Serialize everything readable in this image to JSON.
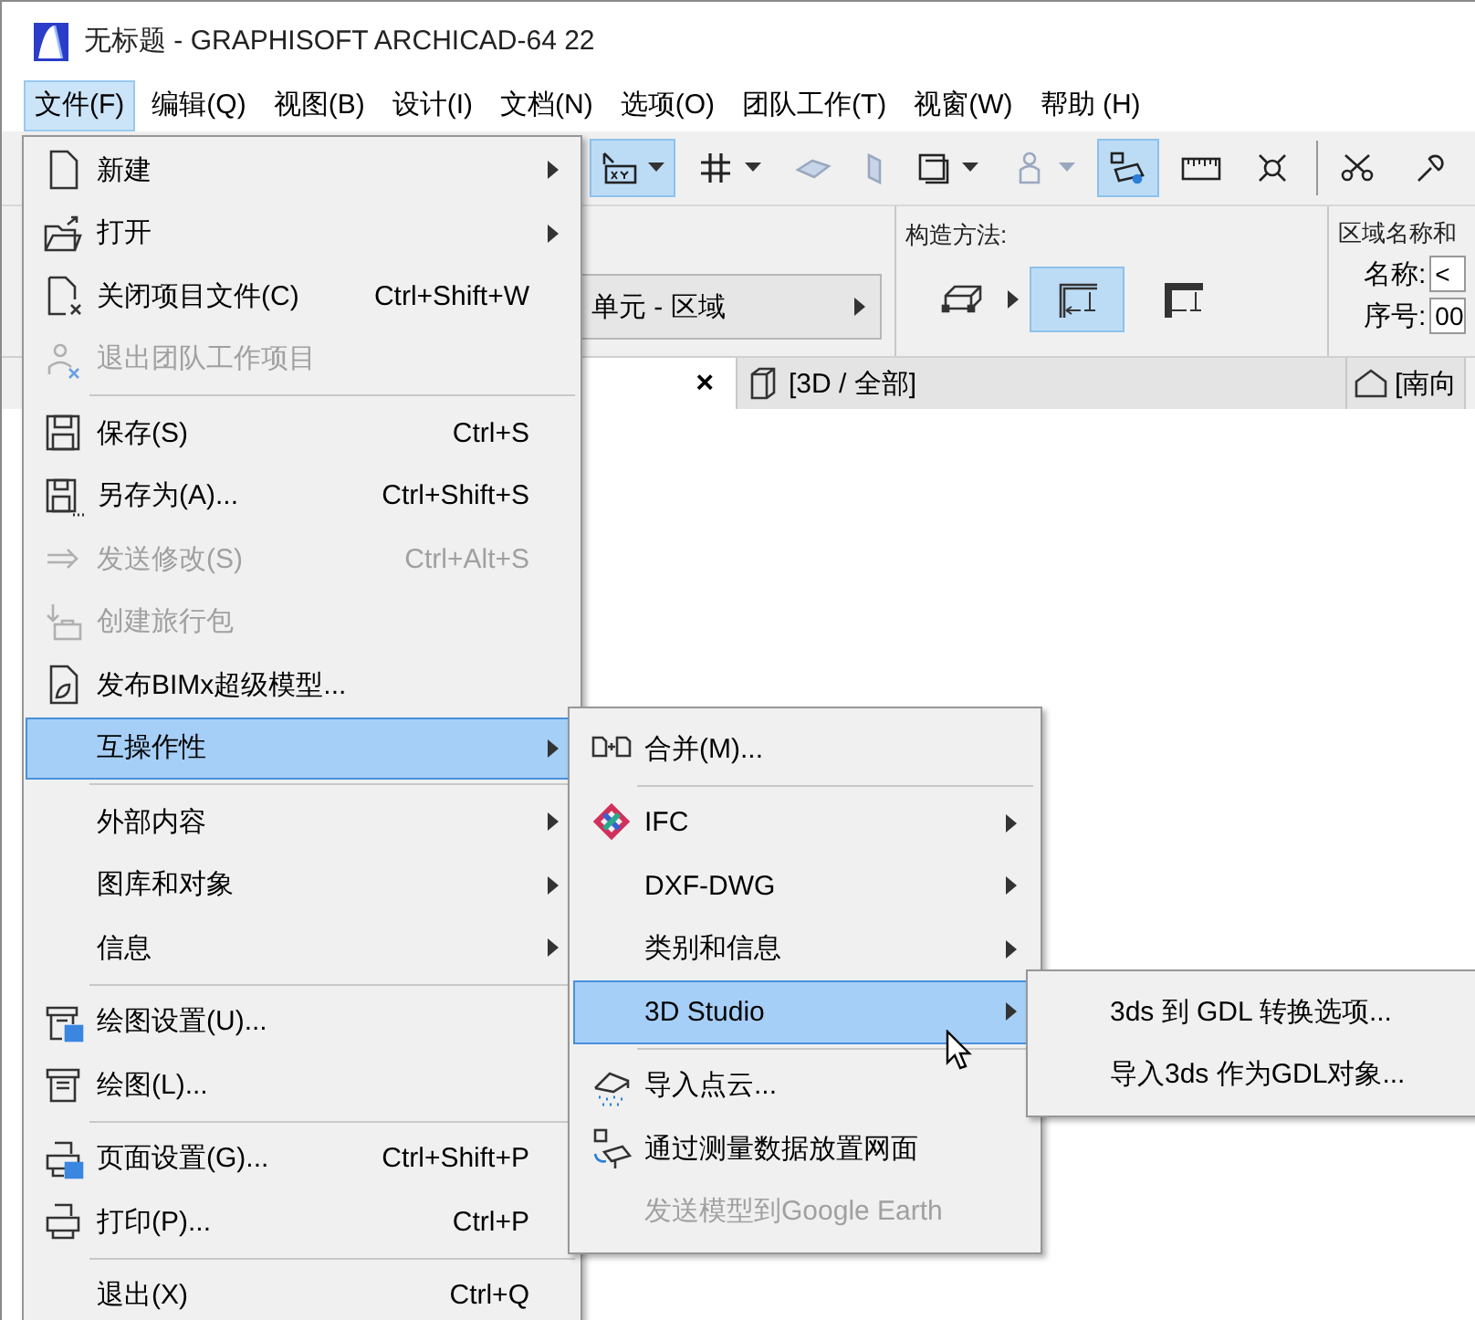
{
  "window": {
    "title": "无标题 - GRAPHISOFT ARCHICAD-64 22"
  },
  "menubar": [
    {
      "label": "文件(F)",
      "selected": true
    },
    {
      "label": "编辑(Q)",
      "selected": false
    },
    {
      "label": "视图(B)",
      "selected": false
    },
    {
      "label": "设计(I)",
      "selected": false
    },
    {
      "label": "文档(N)",
      "selected": false
    },
    {
      "label": "选项(O)",
      "selected": false
    },
    {
      "label": "团队工作(T)",
      "selected": false
    },
    {
      "label": "视窗(W)",
      "selected": false
    },
    {
      "label": "帮助 (H)",
      "selected": false
    }
  ],
  "toolbar": [
    {
      "selected": true,
      "disabled": false,
      "dropdown": true
    },
    {
      "selected": false,
      "disabled": false,
      "dropdown": true
    },
    {
      "selected": false,
      "disabled": true,
      "dropdown": false
    },
    {
      "selected": false,
      "disabled": true,
      "dropdown": false
    },
    {
      "selected": false,
      "disabled": false,
      "dropdown": true
    },
    {
      "selected": false,
      "disabled": true,
      "dropdown": true
    },
    {
      "selected": true,
      "disabled": false,
      "dropdown": false
    },
    {
      "selected": false,
      "disabled": false,
      "dropdown": false
    },
    {
      "selected": false,
      "disabled": false,
      "dropdown": false
    },
    {
      "selected": false,
      "disabled": false,
      "dropdown": false
    },
    {
      "selected": false,
      "disabled": false,
      "dropdown": false
    }
  ],
  "info_box": {
    "element_dropdown": {
      "value": "单元 - 区域"
    },
    "construction": {
      "label": "构造方法:",
      "options": [
        {
          "selected": false
        },
        {
          "selected": true
        },
        {
          "selected": false
        }
      ]
    },
    "zone": {
      "label": "区域名称和",
      "fields": [
        {
          "label": "名称:",
          "value": "<"
        },
        {
          "label": "序号:",
          "value": "00"
        }
      ]
    }
  },
  "tabs": [
    {
      "close": "×",
      "selected": true
    },
    {
      "label": "[3D / 全部]",
      "selected": false
    },
    {
      "label": "[南向",
      "selected": false
    }
  ],
  "file_menu": [
    {
      "kind": "item",
      "label": "新建",
      "submenu": true,
      "disabled": false,
      "selected": false
    },
    {
      "kind": "item",
      "label": "打开",
      "submenu": true,
      "disabled": false,
      "selected": false
    },
    {
      "kind": "item",
      "label": "关闭项目文件(C)",
      "shortcut": "Ctrl+Shift+W",
      "submenu": false,
      "disabled": false,
      "selected": false
    },
    {
      "kind": "item",
      "label": "退出团队工作项目",
      "submenu": false,
      "disabled": true,
      "selected": false
    },
    {
      "kind": "separator"
    },
    {
      "kind": "item",
      "label": "保存(S)",
      "shortcut": "Ctrl+S",
      "submenu": false,
      "disabled": false,
      "selected": false
    },
    {
      "kind": "item",
      "label": "另存为(A)...",
      "shortcut": "Ctrl+Shift+S",
      "submenu": false,
      "disabled": false,
      "selected": false
    },
    {
      "kind": "item",
      "label": "发送修改(S)",
      "shortcut": "Ctrl+Alt+S",
      "submenu": false,
      "disabled": true,
      "selected": false
    },
    {
      "kind": "item",
      "label": "创建旅行包",
      "submenu": false,
      "disabled": true,
      "selected": false
    },
    {
      "kind": "item",
      "label": "发布BIMx超级模型...",
      "submenu": false,
      "disabled": false,
      "selected": false
    },
    {
      "kind": "item",
      "label": "互操作性",
      "submenu": true,
      "disabled": false,
      "selected": true
    },
    {
      "kind": "separator"
    },
    {
      "kind": "item",
      "label": "外部内容",
      "submenu": true,
      "disabled": false,
      "selected": false
    },
    {
      "kind": "item",
      "label": "图库和对象",
      "submenu": true,
      "disabled": false,
      "selected": false
    },
    {
      "kind": "item",
      "label": "信息",
      "submenu": true,
      "disabled": false,
      "selected": false
    },
    {
      "kind": "separator"
    },
    {
      "kind": "item",
      "label": "绘图设置(U)...",
      "submenu": false,
      "disabled": false,
      "selected": false
    },
    {
      "kind": "item",
      "label": "绘图(L)...",
      "submenu": false,
      "disabled": false,
      "selected": false
    },
    {
      "kind": "separator"
    },
    {
      "kind": "item",
      "label": "页面设置(G)...",
      "shortcut": "Ctrl+Shift+P",
      "submenu": false,
      "disabled": false,
      "selected": false
    },
    {
      "kind": "item",
      "label": "打印(P)...",
      "shortcut": "Ctrl+P",
      "submenu": false,
      "disabled": false,
      "selected": false
    },
    {
      "kind": "separator"
    },
    {
      "kind": "item",
      "label": "退出(X)",
      "shortcut": "Ctrl+Q",
      "submenu": false,
      "disabled": false,
      "selected": false
    }
  ],
  "interoperability_menu": [
    {
      "kind": "item",
      "label": "合并(M)...",
      "submenu": false,
      "disabled": false,
      "selected": false
    },
    {
      "kind": "separator"
    },
    {
      "kind": "item",
      "label": "IFC",
      "submenu": true,
      "disabled": false,
      "selected": false
    },
    {
      "kind": "item",
      "label": "DXF-DWG",
      "submenu": true,
      "disabled": false,
      "selected": false
    },
    {
      "kind": "item",
      "label": "类别和信息",
      "submenu": true,
      "disabled": false,
      "selected": false
    },
    {
      "kind": "item",
      "label": "3D Studio",
      "submenu": true,
      "disabled": false,
      "selected": true
    },
    {
      "kind": "separator"
    },
    {
      "kind": "item",
      "label": "导入点云...",
      "submenu": false,
      "disabled": false,
      "selected": false
    },
    {
      "kind": "item",
      "label": "通过测量数据放置网面",
      "submenu": false,
      "disabled": false,
      "selected": false
    },
    {
      "kind": "item",
      "label": "发送模型到Google Earth",
      "submenu": false,
      "disabled": true,
      "selected": false
    }
  ],
  "studio_menu": [
    {
      "kind": "item",
      "label": "3ds 到 GDL 转换选项...",
      "submenu": false,
      "disabled": false,
      "selected": false
    },
    {
      "kind": "item",
      "label": "导入3ds 作为GDL对象...",
      "submenu": false,
      "disabled": false,
      "selected": false
    }
  ]
}
